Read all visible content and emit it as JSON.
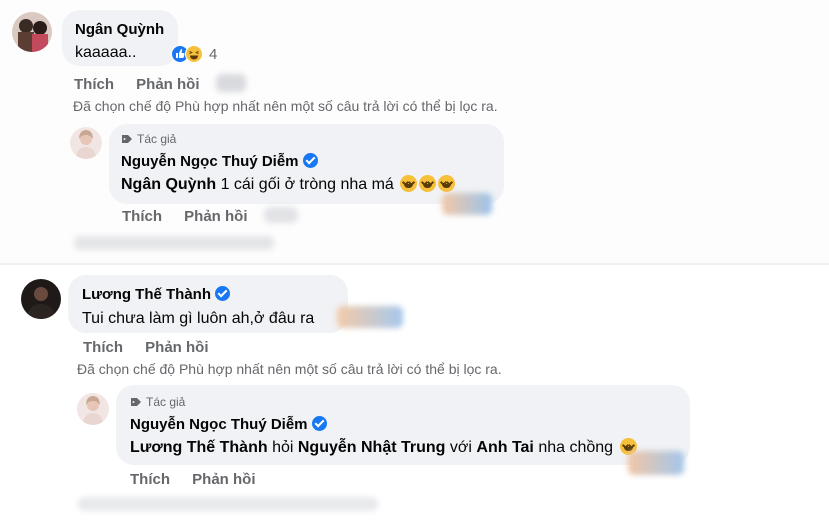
{
  "comments": [
    {
      "author": "Ngân Quỳnh",
      "text": "kaaaaa..",
      "reaction_count": "4",
      "actions": {
        "like": "Thích",
        "reply": "Phản hồi"
      },
      "filter_note": "Đã chọn chế độ Phù hợp nhất nên một số câu trả lời có thể bị lọc ra.",
      "reply": {
        "tag": "Tác giả",
        "author": "Nguyễn Ngọc Thuý Diễm",
        "mention": "Ngân Quỳnh",
        "text": "1 cái gối ở tròng nha má",
        "actions": {
          "like": "Thích",
          "reply": "Phản hồi"
        }
      }
    },
    {
      "author": "Lương Thế Thành",
      "text": "Tui chưa làm gì luôn ah,ở đâu ra",
      "actions": {
        "like": "Thích",
        "reply": "Phản hồi"
      },
      "filter_note": "Đã chọn chế độ Phù hợp nhất nên một số câu trả lời có thể bị lọc ra.",
      "reply": {
        "tag": "Tác giả",
        "author": "Nguyễn Ngọc Thuý Diễm",
        "mention1": "Lương Thế Thành",
        "text1": "hỏi",
        "mention2": "Nguyễn Nhật Trung",
        "text2": "với",
        "mention3": "Anh Tai",
        "text3": "nha chồng",
        "actions": {
          "like": "Thích",
          "reply": "Phản hồi"
        }
      }
    }
  ],
  "colors": {
    "bubble": "#f0f2f5",
    "secondary_text": "#65676b",
    "verified": "#1877f2",
    "like_reaction": "#1877f2",
    "haha_reaction": "#f7c03b"
  },
  "icons": [
    "verified-badge-icon",
    "like-reaction-icon",
    "haha-reaction-icon",
    "laughing-emoji-icon",
    "author-tag-icon"
  ]
}
